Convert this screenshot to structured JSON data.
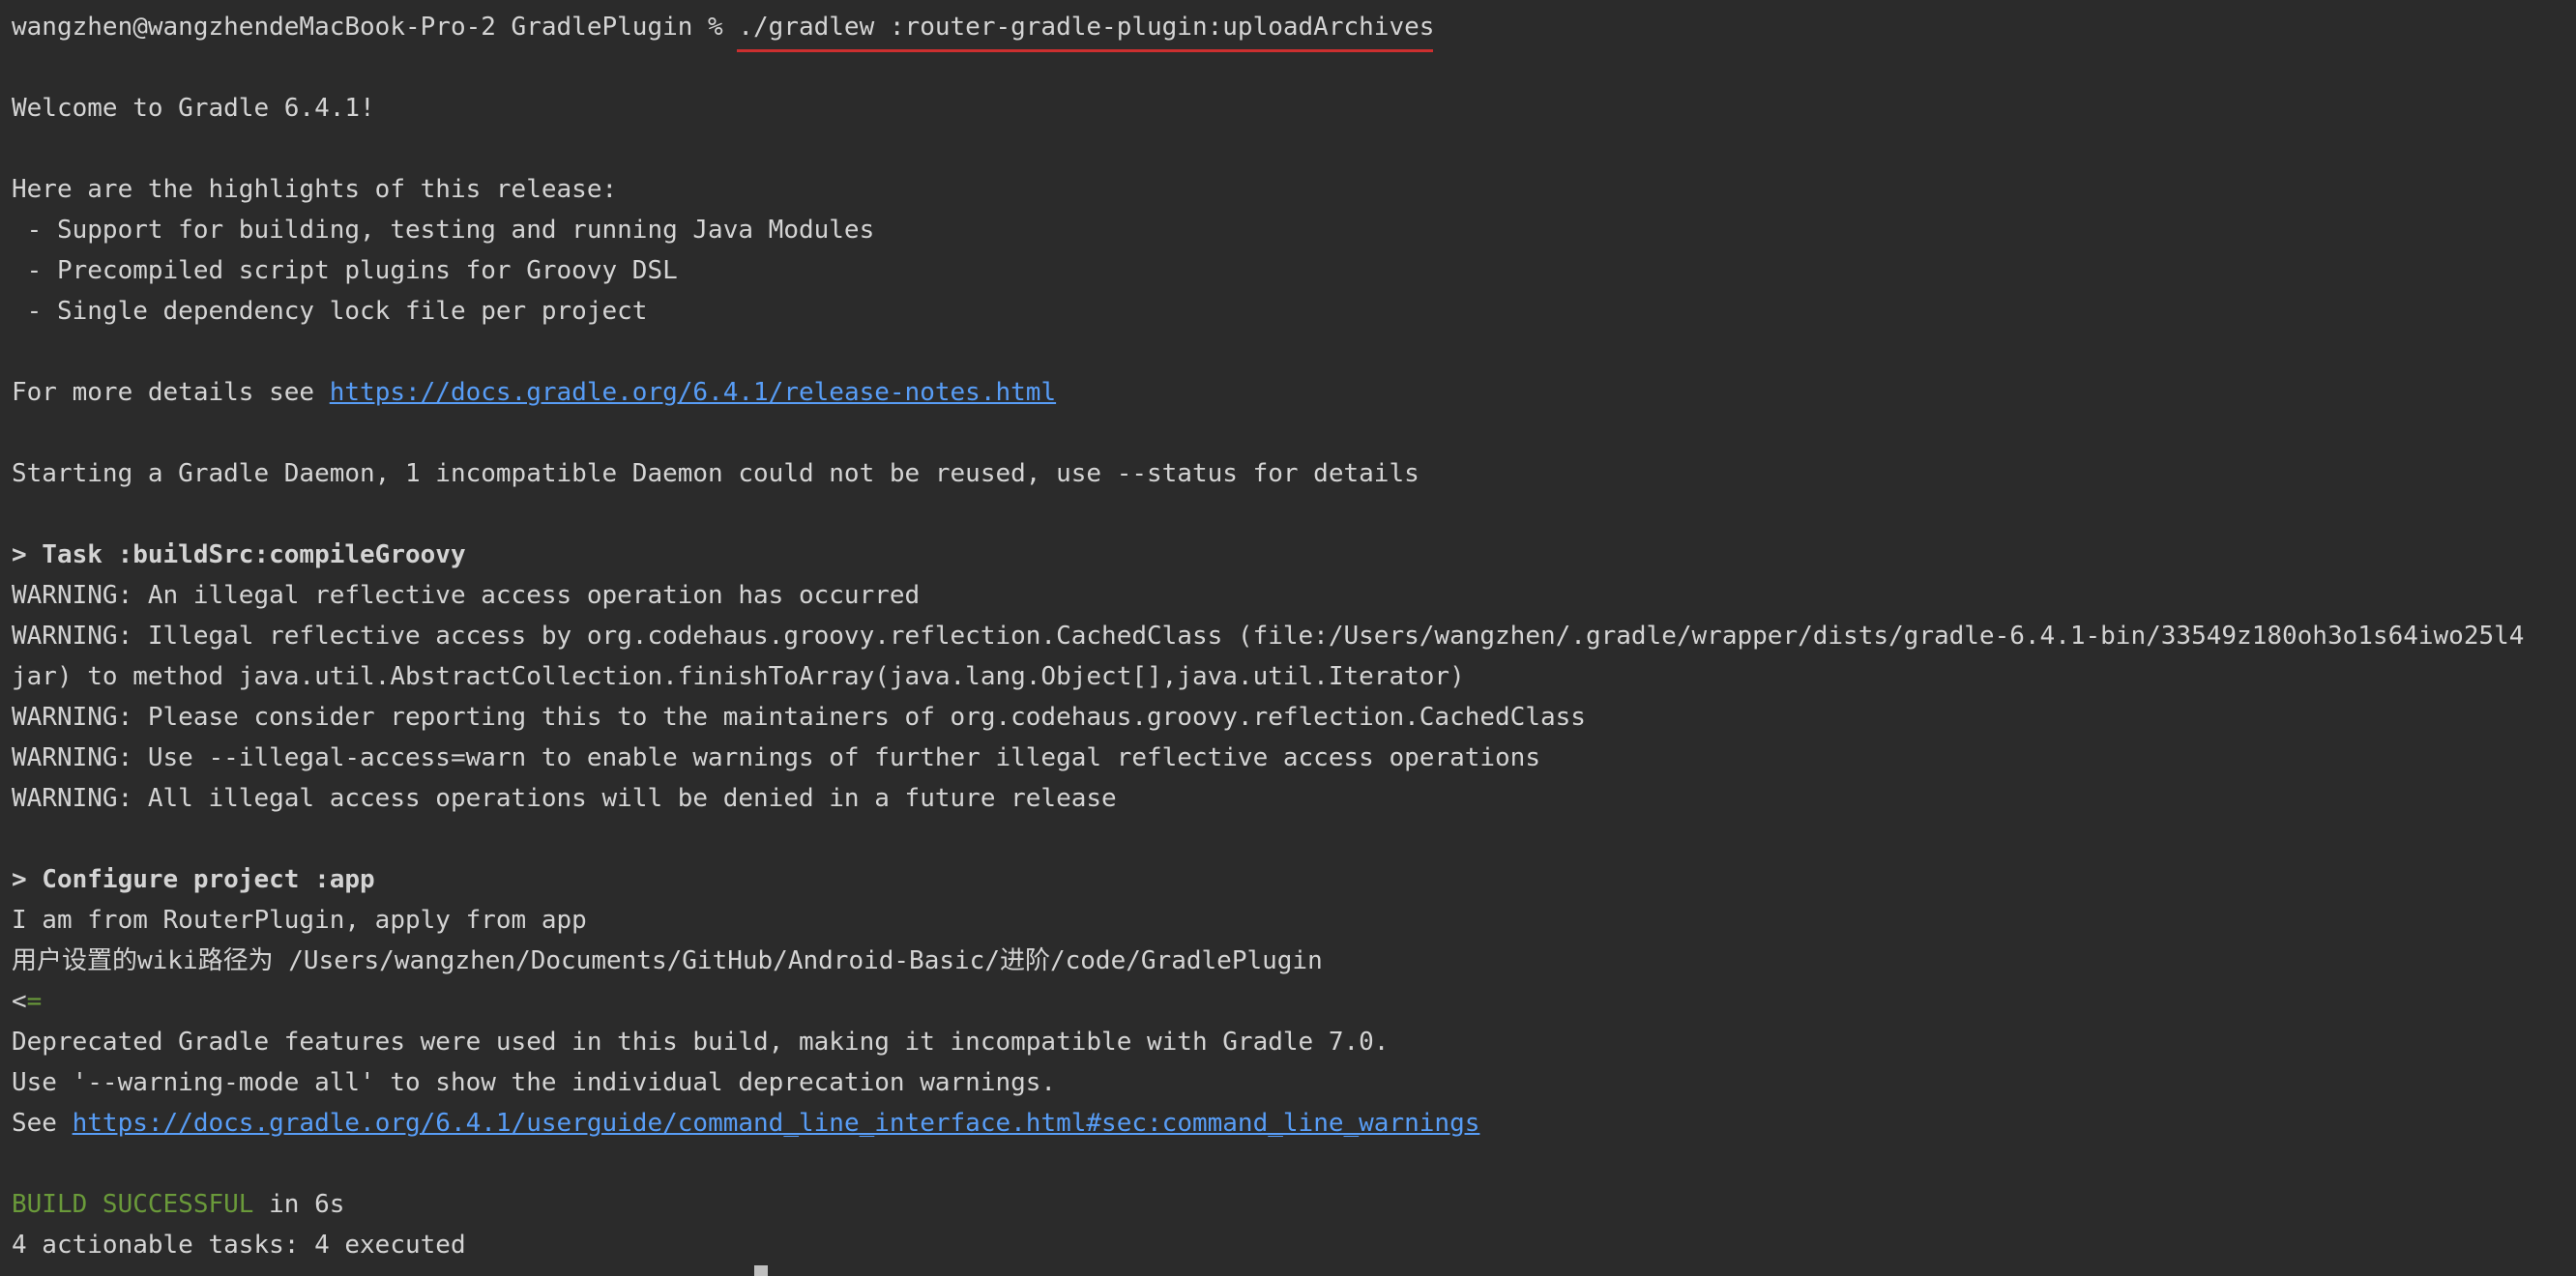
{
  "terminal": {
    "prompt": "wangzhen@wangzhendeMacBook-Pro-2 GradlePlugin % ",
    "command": "./gradlew :router-gradle-plugin:uploadArchives",
    "welcome": "Welcome to Gradle 6.4.1!",
    "highlights_header": "Here are the highlights of this release:",
    "highlights": [
      " - Support for building, testing and running Java Modules",
      " - Precompiled script plugins for Groovy DSL",
      " - Single dependency lock file per project"
    ],
    "details_prefix": "For more details see ",
    "details_link": "https://docs.gradle.org/6.4.1/release-notes.html",
    "daemon_message": "Starting a Gradle Daemon, 1 incompatible Daemon could not be reused, use --status for details",
    "task_compile": "> Task :buildSrc:compileGroovy",
    "warnings": [
      "WARNING: An illegal reflective access operation has occurred",
      "WARNING: Illegal reflective access by org.codehaus.groovy.reflection.CachedClass (file:/Users/wangzhen/.gradle/wrapper/dists/gradle-6.4.1-bin/33549z180oh3o1s64iwo25l4",
      "jar) to method java.util.AbstractCollection.finishToArray(java.lang.Object[],java.util.Iterator)",
      "WARNING: Please consider reporting this to the maintainers of org.codehaus.groovy.reflection.CachedClass",
      "WARNING: Use --illegal-access=warn to enable warnings of further illegal reflective access operations",
      "WARNING: All illegal access operations will be denied in a future release"
    ],
    "configure_project": "> Configure project :app",
    "plugin_message": "I am from RouterPlugin, apply from app",
    "wiki_path": "用户设置的wiki路径为 /Users/wangzhen/Documents/GitHub/Android-Basic/进阶/code/GradlePlugin",
    "progress_open": "<",
    "progress_fill": "=",
    "deprecated_1": "Deprecated Gradle features were used in this build, making it incompatible with Gradle 7.0.",
    "deprecated_2": "Use '--warning-mode all' to show the individual deprecation warnings.",
    "see_prefix": "See ",
    "see_link": "https://docs.gradle.org/6.4.1/userguide/command_line_interface.html#sec:command_line_warnings",
    "build_status": "BUILD SUCCESSFUL",
    "build_time": " in 6s",
    "tasks_summary": "4 actionable tasks: 4 executed"
  },
  "colors": {
    "background": "#2b2b2b",
    "text": "#d4d4d4",
    "link": "#589df6",
    "success": "#6a9a3a",
    "command_underline": "#cc2f2f"
  }
}
